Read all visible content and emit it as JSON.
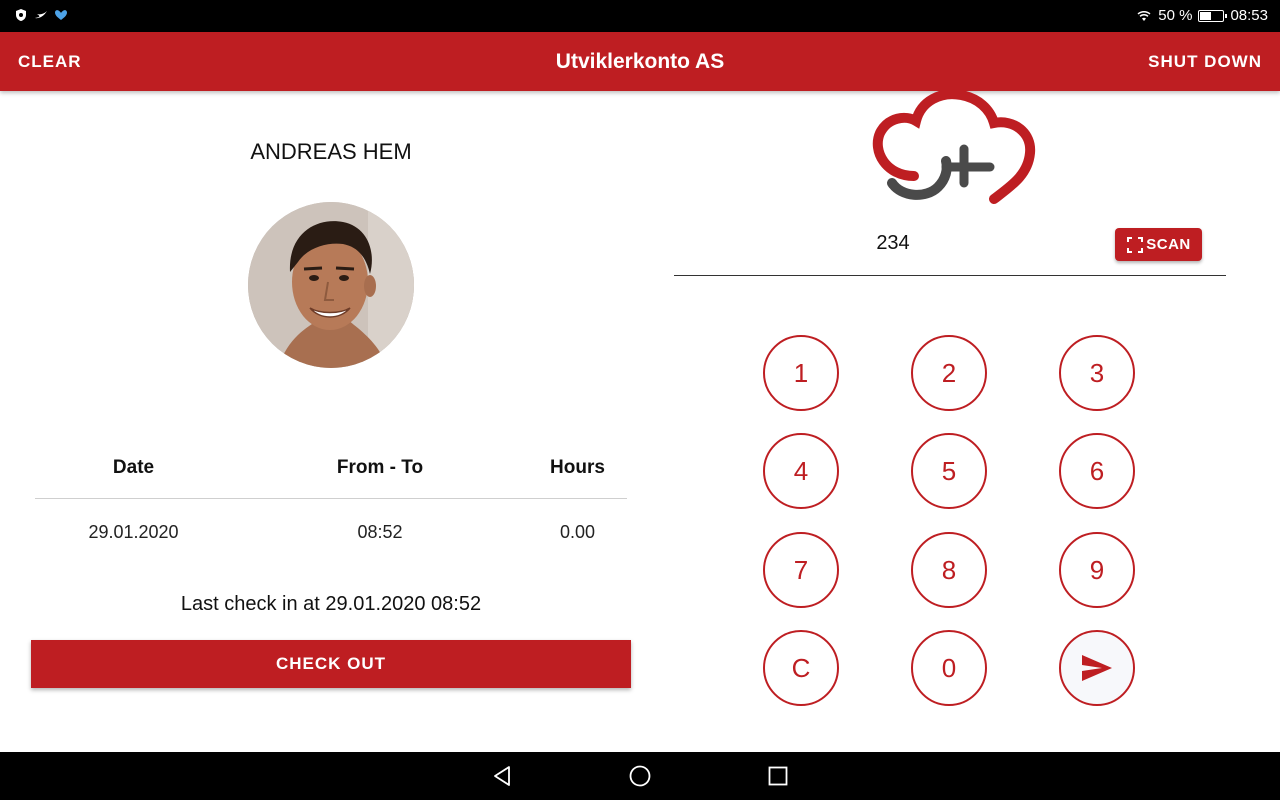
{
  "status_bar": {
    "battery_text": "50 %",
    "battery_level": 0.5,
    "time": "08:53"
  },
  "app_bar": {
    "clear_label": "CLEAR",
    "title": "Utviklerkonto AS",
    "shutdown_label": "SHUT DOWN"
  },
  "employee": {
    "name": "ANDREAS HEM"
  },
  "table": {
    "headers": [
      "Date",
      "From - To",
      "Hours"
    ],
    "rows": [
      [
        "29.01.2020",
        "08:52",
        "0.00"
      ]
    ]
  },
  "last_checkin": "Last check in at 29.01.2020 08:52",
  "checkout_label": "CHECK OUT",
  "pin": {
    "value": "234",
    "scan_label": "SCAN"
  },
  "keypad": {
    "keys": [
      "1",
      "2",
      "3",
      "4",
      "5",
      "6",
      "7",
      "8",
      "9",
      "C",
      "0"
    ]
  },
  "colors": {
    "primary": "#be1e22",
    "status_bar": "#000000",
    "nav_bar": "#000000"
  },
  "icons": {
    "send": "send-icon",
    "scan": "scan-frame-icon",
    "nav_back": "back-triangle-icon",
    "nav_home": "home-circle-icon",
    "nav_recents": "recents-square-icon"
  }
}
